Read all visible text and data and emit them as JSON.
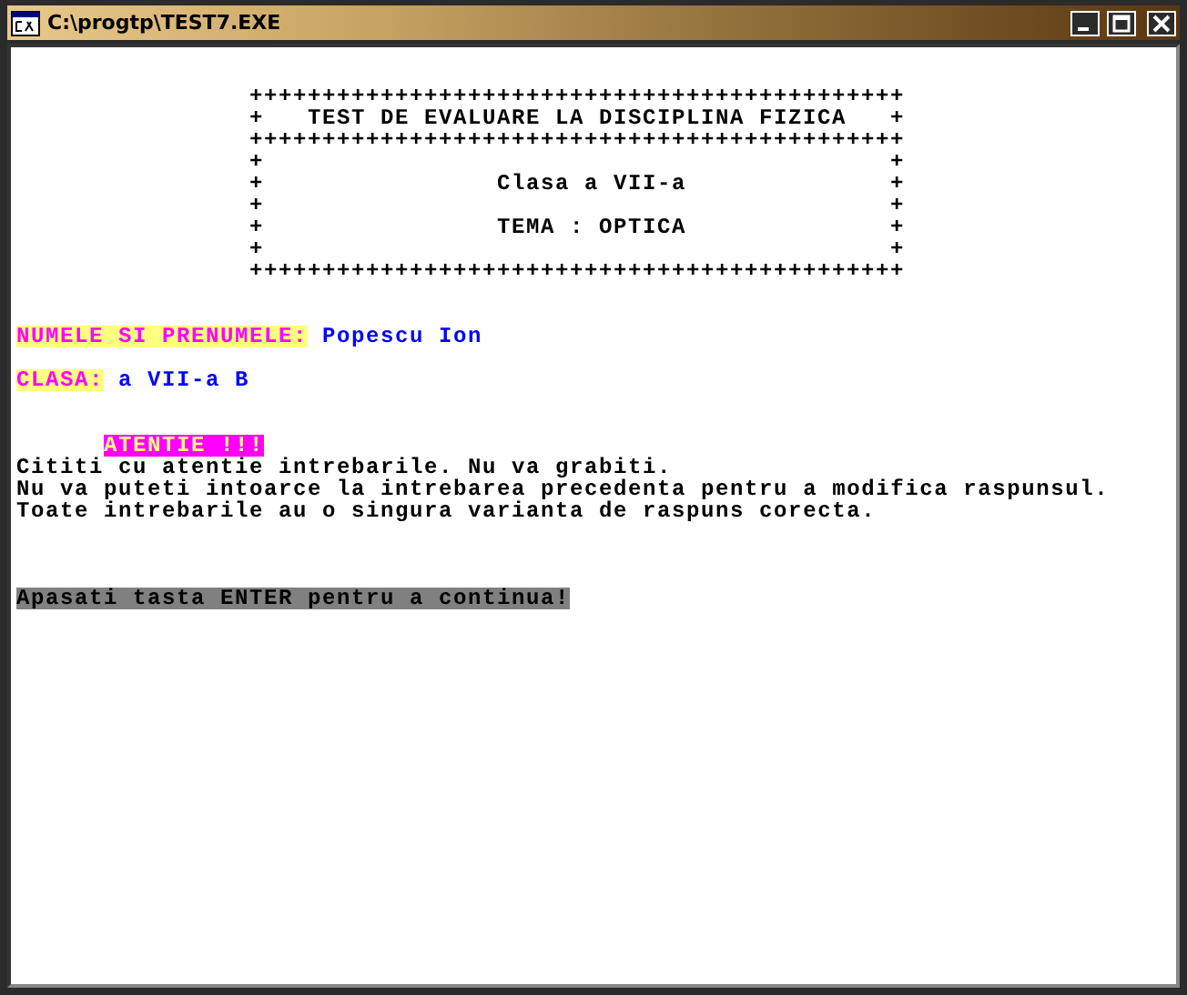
{
  "window": {
    "title": "C:\\progtp\\TEST7.EXE"
  },
  "banner": {
    "lines": [
      "+++++++++++++++++++++++++++++++++++++++++++++",
      "+   TEST DE EVALUARE LA DISCIPLINA FIZICA   +",
      "+++++++++++++++++++++++++++++++++++++++++++++",
      "+                                           +",
      "+                Clasa a VII-a              +",
      "+                                           +",
      "+                TEMA : OPTICA              +",
      "+                                           +",
      "+++++++++++++++++++++++++++++++++++++++++++++"
    ]
  },
  "student": {
    "label": "NUMELE SI PRENUMELE:",
    "value": "Popescu Ion"
  },
  "class": {
    "label": "CLASA:",
    "value": "a VII-a B"
  },
  "attention": {
    "title": "ATENTIE !!!",
    "lines": [
      "Cititi cu atentie intrebarile. Nu va grabiti.",
      "Nu va puteti intoarce la intrebarea precedenta pentru a modifica raspunsul.",
      "Toate intrebarile au o singura varianta de raspuns corecta."
    ]
  },
  "prompt": "Apasati tasta ENTER pentru a continua!"
}
